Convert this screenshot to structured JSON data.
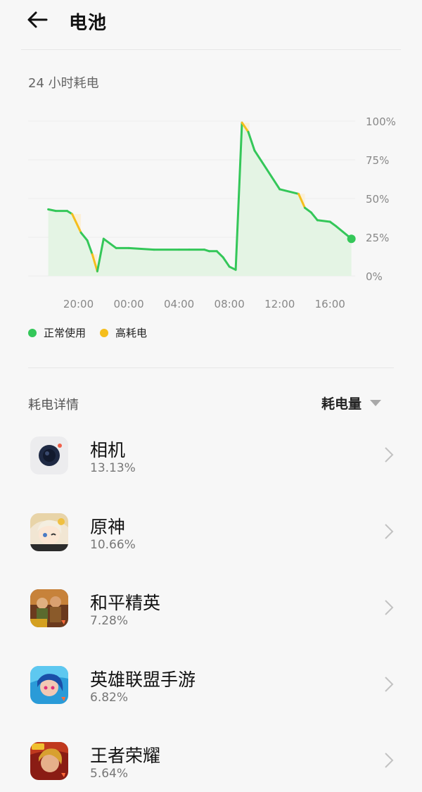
{
  "header": {
    "title": "电池",
    "back_icon": "back-arrow-icon"
  },
  "chart_section": {
    "title": "24 小时耗电"
  },
  "chart_data": {
    "type": "area",
    "title": "24 小时耗电",
    "x_labels": [
      "20:00",
      "00:00",
      "04:00",
      "08:00",
      "12:00",
      "16:00"
    ],
    "y_labels": [
      "100%",
      "75%",
      "50%",
      "25%",
      "0%"
    ],
    "ylim": [
      0,
      100
    ],
    "grid": true,
    "series": [
      {
        "name": "正常使用",
        "color": "#34c759"
      },
      {
        "name": "高耗电",
        "color": "#f5be1c"
      }
    ],
    "time_hours": [
      17.6,
      18.2,
      19.1,
      19.5,
      20.2,
      20.7,
      21.1,
      21.5,
      22.0,
      23.0,
      24.0,
      26.0,
      28.0,
      28.8,
      30.0,
      30.4,
      31.0,
      31.5,
      32.0,
      32.5,
      33.0,
      33.5,
      34.0,
      36.0,
      37.5,
      38.0,
      38.5,
      39.0,
      40.0,
      40.5,
      41.7
    ],
    "level_pct": [
      43,
      42,
      42,
      40,
      28,
      23,
      14,
      3,
      24,
      18,
      18,
      17,
      17,
      17,
      17,
      16,
      16,
      12,
      6,
      4,
      99,
      93,
      81,
      56,
      53,
      44,
      41,
      36,
      35,
      32,
      24
    ],
    "high_drain_intervals": [
      [
        19.5,
        20.2
      ],
      [
        21.1,
        21.5
      ],
      [
        33.0,
        33.6
      ],
      [
        37.5,
        38.0
      ]
    ]
  },
  "detail": {
    "title": "耗电详情",
    "sort_label": "耗电量"
  },
  "apps": [
    {
      "name": "相机",
      "pct": "13.13%",
      "icon": "camera-icon"
    },
    {
      "name": "原神",
      "pct": "10.66%",
      "icon": "genshin-icon"
    },
    {
      "name": "和平精英",
      "pct": "7.28%",
      "icon": "peace-elite-icon"
    },
    {
      "name": "英雄联盟手游",
      "pct": "6.82%",
      "icon": "lol-wild-rift-icon"
    },
    {
      "name": "王者荣耀",
      "pct": "5.64%",
      "icon": "honor-of-kings-icon"
    }
  ],
  "colors": {
    "normal": "#34c759",
    "high": "#f5be1c",
    "fill": "#e4f4e4",
    "high_fill": "#fbf0d8"
  }
}
